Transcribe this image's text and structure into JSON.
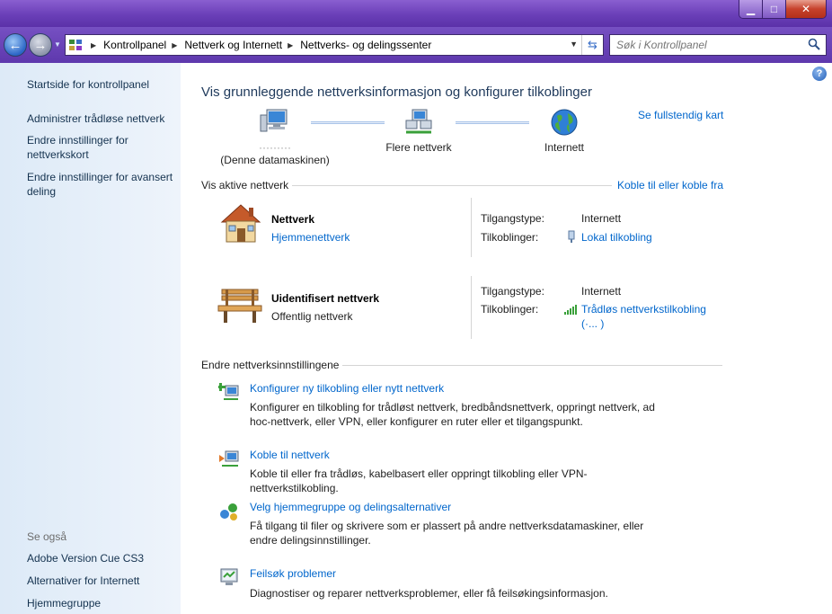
{
  "window": {
    "minimize": "▁",
    "maximize": "□",
    "close": "✕"
  },
  "address": {
    "crumbs": [
      "Kontrollpanel",
      "Nettverk og Internett",
      "Nettverks- og delingssenter"
    ],
    "search_placeholder": "Søk i Kontrollpanel"
  },
  "sidebar": {
    "links": [
      "Startside for kontrollpanel",
      "Administrer trådløse nettverk",
      "Endre innstillinger for nettverkskort",
      "Endre innstillinger for avansert deling"
    ],
    "see_also_heading": "Se også",
    "see_also": [
      "Adobe Version Cue CS3",
      "Alternativer for Internett",
      "Hjemmegruppe"
    ]
  },
  "main": {
    "title": "Vis grunnleggende nettverksinformasjon og konfigurer tilkoblinger",
    "full_map": "Se fullstendig kart",
    "map": {
      "computer_name": "·········",
      "computer_sub": "(Denne datamaskinen)",
      "middle": "Flere nettverk",
      "internet": "Internett"
    },
    "active_heading": "Vis aktive nettverk",
    "connect_link": "Koble til eller koble fra",
    "networks": [
      {
        "name": "Nettverk",
        "type": "Hjemmenettverk",
        "access_label": "Tilgangstype:",
        "access_value": "Internett",
        "conn_label": "Tilkoblinger:",
        "conn_value": "Lokal tilkobling"
      },
      {
        "name": "Uidentifisert nettverk",
        "type": "Offentlig nettverk",
        "access_label": "Tilgangstype:",
        "access_value": "Internett",
        "conn_label": "Tilkoblinger:",
        "conn_value": "Trådløs nettverkstilkobling",
        "conn_value2": "(·...            )"
      }
    ],
    "change_heading": "Endre nettverksinnstillingene",
    "tasks": [
      {
        "title": "Konfigurer ny tilkobling eller nytt nettverk",
        "desc": "Konfigurer en tilkobling for trådløst nettverk, bredbåndsnettverk, oppringt nettverk, ad hoc-nettverk, eller VPN, eller konfigurer en ruter eller et tilgangspunkt."
      },
      {
        "title": "Koble til nettverk",
        "desc": "Koble til eller fra trådløs, kabelbasert eller oppringt tilkobling eller VPN-nettverkstilkobling."
      },
      {
        "title": "Velg hjemmegruppe og delingsalternativer",
        "desc": "Få tilgang til filer og skrivere som er plassert på andre nettverksdatamaskiner, eller endre delingsinnstillinger."
      },
      {
        "title": "Feilsøk problemer",
        "desc": "Diagnostiser og reparer nettverksproblemer, eller få feilsøkingsinformasjon."
      }
    ]
  }
}
